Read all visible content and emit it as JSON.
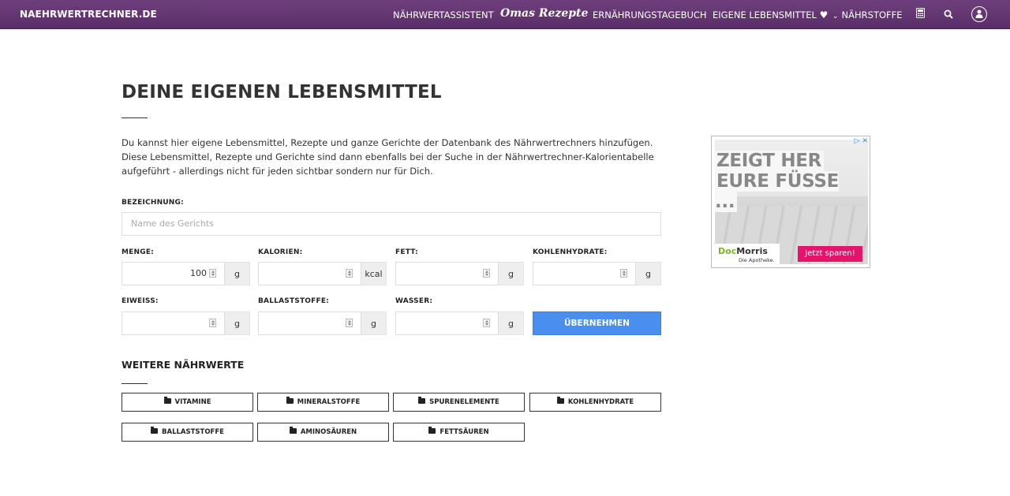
{
  "navbar": {
    "brand": "NAEHRWERTRECHNER.DE",
    "items": [
      {
        "label": "NÄHRWERTASSISTENT"
      },
      {
        "label": "Omas Rezepte"
      },
      {
        "label": "ERNÄHRUNGSTAGEBUCH"
      },
      {
        "label": "EIGENE LEBENSMITTEL"
      },
      {
        "label": "NÄHRSTOFFE"
      }
    ],
    "icons": [
      "heart-icon",
      "chevron-down-icon",
      "calculator-icon",
      "search-icon",
      "user-icon"
    ]
  },
  "main": {
    "title": "DEINE EIGENEN LEBENSMITTEL",
    "intro": "Du kannst hier eigene Lebensmittel, Rezepte und ganze Gerichte der Datenbank des Nährwertrechners hinzufügen. Diese Lebensmittel, Rezepte und Gerichte sind dann ebenfalls bei der Suche in der Nährwertrechner-Kalorientabelle aufgeführt - allerdings nicht für jeden sichtbar sondern nur für Dich.",
    "name_field": {
      "label": "BEZEICHNUNG:",
      "placeholder": "Name des Gerichts",
      "value": ""
    },
    "fields": {
      "menge": {
        "label": "MENGE:",
        "value": "100",
        "unit": "g"
      },
      "kalorien": {
        "label": "KALORIEN:",
        "value": "",
        "unit": "kcal"
      },
      "fett": {
        "label": "FETT:",
        "value": "",
        "unit": "g"
      },
      "kohlenhydrate": {
        "label": "KOHLENHYDRATE:",
        "value": "",
        "unit": "g"
      },
      "eiweiss": {
        "label": "EIWEISS:",
        "value": "",
        "unit": "g"
      },
      "ballaststoffe": {
        "label": "BALLASTSTOFFE:",
        "value": "",
        "unit": "g"
      },
      "wasser": {
        "label": "WASSER:",
        "value": "",
        "unit": "g"
      }
    },
    "submit_label": "ÜBERNEHMEN",
    "more_title": "WEITERE NÄHRWERTE",
    "categories": [
      "VITAMINE",
      "MINERALSTOFFE",
      "SPURENELEMENTE",
      "KOHLENHYDRATE",
      "BALLASTSTOFFE",
      "AMINOSÄUREN",
      "FETTSÄUREN"
    ]
  },
  "ad": {
    "headline_1": "ZEIGT HER",
    "headline_2": "EURE FÜSSE ...",
    "brand_a": "Doc",
    "brand_b": "Morris",
    "brand_sub": "Die Apotheke.",
    "cta": "Jetzt sparen!",
    "choices": "▷ ✕"
  },
  "colors": {
    "navbar": "#5f3370",
    "primary_button": "#4a8ff0",
    "ad_cta": "#e2156b",
    "ad_brand": "#7ab51d"
  }
}
